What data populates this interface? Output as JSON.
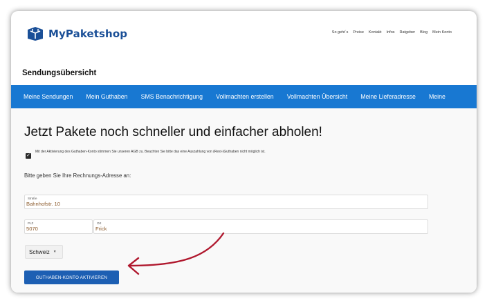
{
  "brand": {
    "name": "MyPaketshop",
    "color": "#1a4f97"
  },
  "top_nav": [
    "So geht´s",
    "Preise",
    "Kontakt",
    "Infos",
    "Ratgeber",
    "Blog",
    "Mein Konto"
  ],
  "page_title": "Sendungsübersicht",
  "main_nav": [
    "Meine Sendungen",
    "Mein Guthaben",
    "SMS Benachrichtigung",
    "Vollmachten erstellen",
    "Vollmachten Übersicht",
    "Meine Lieferadresse",
    "Meine"
  ],
  "headline": "Jetzt Pakete noch schneller und einfacher abholen!",
  "agb_text": "Mit der Aktivierung des Guthaben-Konto stimmen Sie unseren AGB zu. Beachten Sie bitte das eine Auszahlung von (Rest-)Guthaben nicht möglich ist.",
  "agb_checked": true,
  "billing_label": "Bitte geben Sie Ihre Rechnungs-Adresse an:",
  "fields": {
    "street": {
      "label": "Straße",
      "value": "Bahnhofstr. 10"
    },
    "zip": {
      "label": "PLZ",
      "value": "5070"
    },
    "city": {
      "label": "Ort",
      "value": "Frick"
    }
  },
  "country": "Schweiz",
  "activate_label": "GUTHABEN-KONTO AKTIVIEREN",
  "colors": {
    "nav": "#1878d2",
    "button": "#1d5fb3",
    "arrow": "#b0182e"
  }
}
